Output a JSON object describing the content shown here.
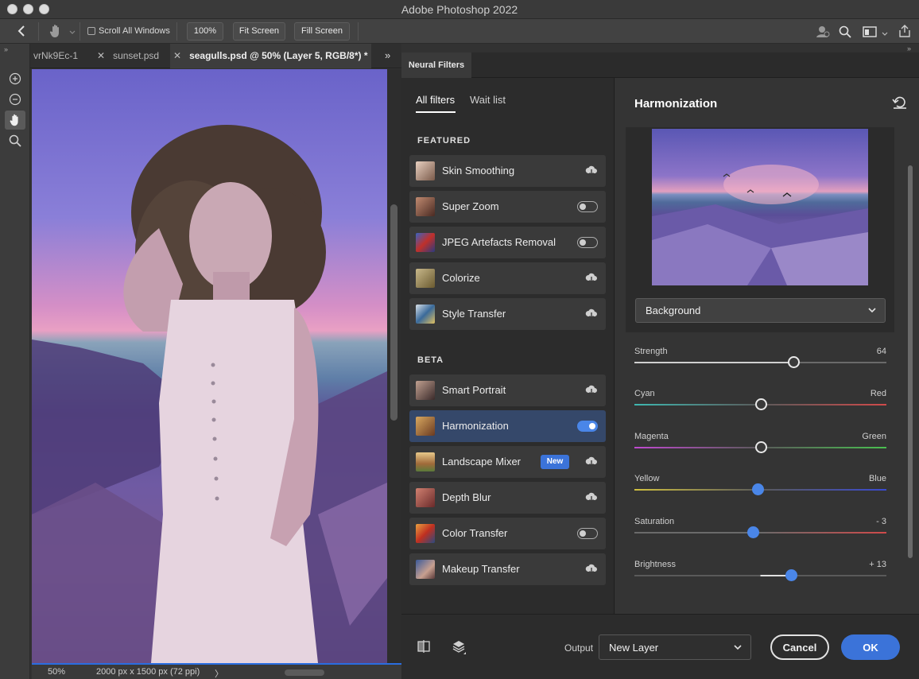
{
  "window": {
    "title": "Adobe Photoshop 2022"
  },
  "options_bar": {
    "scroll_all_windows": {
      "label": "Scroll All Windows",
      "checked": false
    },
    "zoom_100": "100%",
    "fit_screen": "Fit Screen",
    "fill_screen": "Fill Screen"
  },
  "document_tabs": [
    {
      "label": "vrNk9Ec-1",
      "active": false
    },
    {
      "label": "sunset.psd",
      "active": false
    },
    {
      "label": "seagulls.psd @ 50% (Layer 5, RGB/8*) *",
      "active": true
    }
  ],
  "status_bar": {
    "zoom": "50%",
    "doc_info": "2000 px x 1500 px (72 ppi)",
    "arrow": "〉"
  },
  "neural_filters": {
    "panel_tab": "Neural Filters",
    "subtabs": [
      {
        "label": "All filters",
        "active": true
      },
      {
        "label": "Wait list",
        "active": false
      }
    ],
    "featured_label": "FEATURED",
    "beta_label": "BETA",
    "featured": [
      {
        "name": "Skin Smoothing",
        "state": "download"
      },
      {
        "name": "Super Zoom",
        "state": "toggle-off"
      },
      {
        "name": "JPEG Artefacts Removal",
        "state": "toggle-off"
      },
      {
        "name": "Colorize",
        "state": "download"
      },
      {
        "name": "Style Transfer",
        "state": "download"
      }
    ],
    "beta": [
      {
        "name": "Smart Portrait",
        "state": "download"
      },
      {
        "name": "Harmonization",
        "state": "toggle-on",
        "selected": true
      },
      {
        "name": "Landscape Mixer",
        "state": "download",
        "badge": "New"
      },
      {
        "name": "Depth Blur",
        "state": "download"
      },
      {
        "name": "Color Transfer",
        "state": "toggle-off"
      },
      {
        "name": "Makeup Transfer",
        "state": "download"
      }
    ]
  },
  "harmonization": {
    "title": "Harmonization",
    "layer_select": "Background",
    "sliders": {
      "strength": {
        "label": "Strength",
        "right_label": "64",
        "position": 0.63
      },
      "cyan_red": {
        "label": "Cyan",
        "right_label": "Red",
        "position": 0.5
      },
      "magenta_green": {
        "label": "Magenta",
        "right_label": "Green",
        "position": 0.5
      },
      "yellow_blue": {
        "label": "Yellow",
        "right_label": "Blue",
        "position": 0.49
      },
      "saturation": {
        "label": "Saturation",
        "right_label": "- 3",
        "position": 0.47
      },
      "brightness": {
        "label": "Brightness",
        "right_label": "+ 13",
        "position": 0.62
      }
    }
  },
  "footer": {
    "output_label": "Output",
    "output_value": "New Layer",
    "cancel": "Cancel",
    "ok": "OK"
  },
  "colors": {
    "accent": "#3b73d9",
    "selected_row": "#35486a",
    "panel": "#2c2c2c"
  }
}
